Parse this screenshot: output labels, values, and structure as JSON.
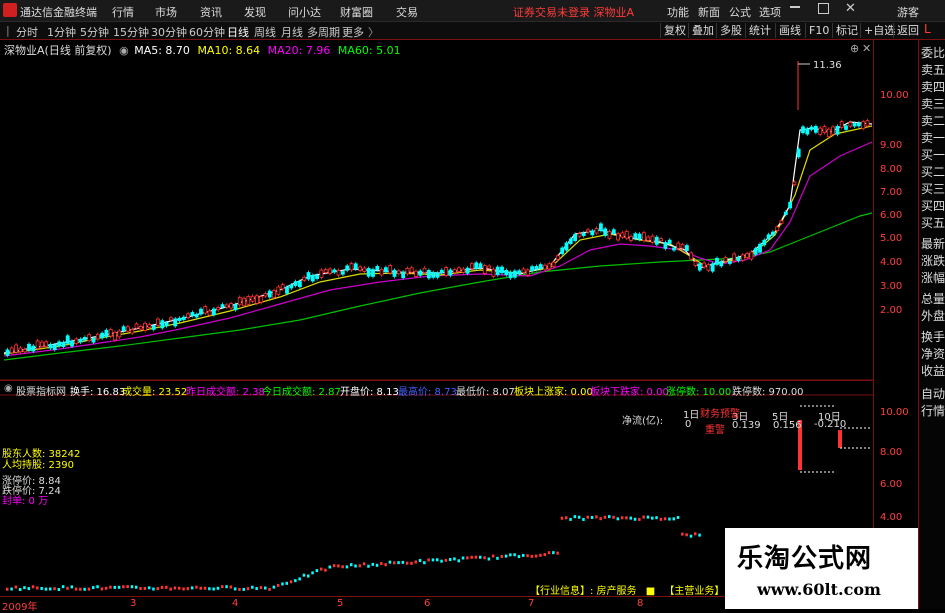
{
  "titlebar": {
    "app_title": "通达信金融终端",
    "menus": [
      "行情",
      "市场",
      "资讯",
      "发现",
      "问小达",
      "财富圈",
      "交易"
    ],
    "notice": "证券交易未登录  深物业A",
    "right_menus": [
      "功能",
      "新面",
      "公式",
      "选项"
    ],
    "guest": "游客"
  },
  "toolbar": {
    "timeframes": [
      "分时",
      "1分钟",
      "5分钟",
      "15分钟",
      "30分钟",
      "60分钟",
      "日线",
      "周线",
      "月线",
      "多周期",
      "更多"
    ],
    "active_timeframe": "日线",
    "buttons": [
      "复权",
      "叠加",
      "多股",
      "统计",
      "画线",
      "F10",
      "标记",
      "+自选",
      "返回"
    ]
  },
  "chart_header": {
    "stock_label": "深物业A(日线 前复权)",
    "ma5": "MA5: 8.70",
    "ma10": "MA10: 8.64",
    "ma20": "MA20: 7.96",
    "ma60": "MA60: 5.01",
    "ma5_color": "#ffffff",
    "ma10_color": "#ffff00",
    "ma20_color": "#ff00ff",
    "ma60_color": "#00ff00"
  },
  "peak_label": "11.36",
  "right_panel": {
    "items": [
      "委比",
      "卖五",
      "卖四",
      "卖三",
      "卖二",
      "卖一",
      "买一",
      "买二",
      "买三",
      "买四",
      "买五",
      "最新",
      "涨跌",
      "涨幅",
      "总量",
      "外盘",
      "换手",
      "净资",
      "收益",
      "自动",
      "行情"
    ]
  },
  "price_axis": [
    "10.00",
    "9.00",
    "8.00",
    "7.00",
    "6.00",
    "5.00",
    "4.00",
    "3.00",
    "2.00"
  ],
  "lower_axis": [
    "10.00",
    "8.00",
    "6.00",
    "4.00"
  ],
  "indicator_bar": {
    "name": "股票指标网",
    "turnover": "换手: 16.83",
    "volume": "成交量: 23.52",
    "prev_amount": "昨日成交额: 2.38",
    "today_amount": "今日成交额: 2.87",
    "open": "开盘价: 8.13",
    "high": "最高价: 8.73",
    "low": "最低价: 8.07",
    "up_count": "板块上涨家: 0.00",
    "down_count": "板块下跌家: 0.00",
    "limit_up": "涨停数: 10.00",
    "limit_down": "跌停数: 970.00"
  },
  "net_flow": {
    "label": "净流(亿):",
    "d1": "1日",
    "d1v": "0",
    "d3": "3日",
    "d3v": "0.139",
    "d5": "5日",
    "d5v": "0.156",
    "d10": "10日",
    "d10v": "-0.210",
    "warn1": "财务预警",
    "warn2": "重警"
  },
  "side_info": {
    "holders": "股东人数: 38242",
    "per_holder": "人均持股: 2390",
    "limit_up_price": "涨停价: 8.84",
    "limit_down_price": "跌停价: 7.24",
    "seal": "封单: 0 万"
  },
  "industry": {
    "label": "【行业信息】: 房产服务",
    "business": "【主营业务】"
  },
  "date_axis": [
    "2009年",
    "3",
    "4",
    "5",
    "6",
    "7",
    "8"
  ],
  "watermark": {
    "title": "乐淘公式网",
    "url": "www.60lt.com"
  },
  "colors": {
    "up": "#ff3333",
    "down": "#00ffff",
    "accent": "#7a1010"
  }
}
